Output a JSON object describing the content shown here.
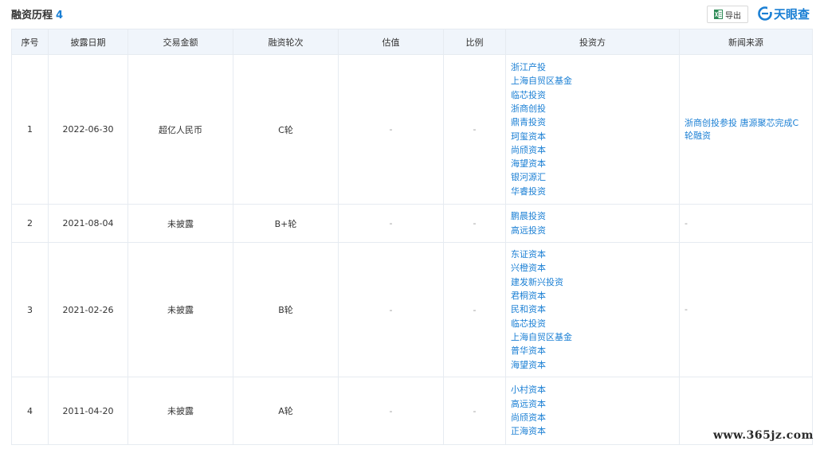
{
  "header": {
    "title": "融资历程",
    "count": "4",
    "export_label": "导出",
    "logo_text": "天眼查"
  },
  "table": {
    "columns": [
      "序号",
      "披露日期",
      "交易金额",
      "融资轮次",
      "估值",
      "比例",
      "投资方",
      "新闻来源"
    ],
    "rows": [
      {
        "index": "1",
        "date": "2022-06-30",
        "amount": "超亿人民币",
        "round": "C轮",
        "valuation": "-",
        "ratio": "-",
        "investors": [
          "浙江产投",
          "上海自贸区基金",
          "临芯投资",
          "浙商创投",
          "鼎青投资",
          "珂玺资本",
          "尚颀资本",
          "海望资本",
          "银河源汇",
          "华睿投资"
        ],
        "news": "浙商创投参投 唐源聚芯完成C轮融资"
      },
      {
        "index": "2",
        "date": "2021-08-04",
        "amount": "未披露",
        "round": "B+轮",
        "valuation": "-",
        "ratio": "-",
        "investors": [
          "鹏晨投资",
          "高远投资"
        ],
        "news": "-"
      },
      {
        "index": "3",
        "date": "2021-02-26",
        "amount": "未披露",
        "round": "B轮",
        "valuation": "-",
        "ratio": "-",
        "investors": [
          "东证资本",
          "兴橙资本",
          "建发新兴投资",
          "君桐资本",
          "民和资本",
          "临芯投资",
          "上海自贸区基金",
          "普华资本",
          "海望资本"
        ],
        "news": "-"
      },
      {
        "index": "4",
        "date": "2011-04-20",
        "amount": "未披露",
        "round": "A轮",
        "valuation": "-",
        "ratio": "-",
        "investors": [
          "小村资本",
          "高远资本",
          "尚颀资本",
          "正海资本"
        ],
        "news": ""
      }
    ]
  },
  "watermark": "www.365jz.com",
  "colors": {
    "accent": "#1a7fd4",
    "header_bg": "#f0f5fb",
    "border": "#e6ebf1"
  }
}
